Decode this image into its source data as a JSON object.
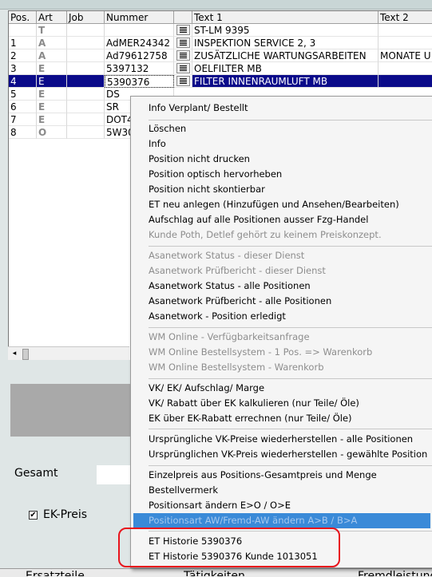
{
  "grid": {
    "columns": [
      "Pos.",
      "Art",
      "Job",
      "Nummer",
      "",
      "Text 1",
      "Text 2"
    ],
    "rows": [
      {
        "pos": "",
        "art": "T",
        "job": "",
        "nummer": "",
        "text1": "ST-LM 9395",
        "text2": ""
      },
      {
        "pos": "1",
        "art": "A",
        "job": "",
        "nummer": "AdMER24342",
        "text1": "INSPEKTION SERVICE 2, 3",
        "text2": ""
      },
      {
        "pos": "2",
        "art": "A",
        "job": "",
        "nummer": "Ad79612758",
        "text1": "ZUSÄTZLICHE WARTUNGSARBEITEN",
        "text2": "MONATE U"
      },
      {
        "pos": "3",
        "art": "E",
        "job": "",
        "nummer": "5397132",
        "text1": "OELFILTER MB",
        "text2": ""
      },
      {
        "pos": "4",
        "art": "E",
        "job": "",
        "nummer": "5390376",
        "text1": "FILTER INNENRAUMLUFT MB",
        "text2": ""
      },
      {
        "pos": "5",
        "art": "E",
        "job": "",
        "nummer": "DS",
        "text1": "",
        "text2": ""
      },
      {
        "pos": "6",
        "art": "E",
        "job": "",
        "nummer": "SR",
        "text1": "",
        "text2": ""
      },
      {
        "pos": "7",
        "art": "E",
        "job": "",
        "nummer": "DOT4",
        "text1": "",
        "text2": ""
      },
      {
        "pos": "8",
        "art": "O",
        "job": "",
        "nummer": "5W30",
        "text1": "",
        "text2": ""
      }
    ],
    "selected_row": 4
  },
  "scrollbar": {
    "left_arrow": "◂"
  },
  "footer": {
    "gesamt_label": "Gesamt",
    "ek_preis_label": "EK-Preis",
    "ek_preis_checked": "✔",
    "tabs": [
      "Ersatzteile",
      "Tätigkeiten",
      "Fremdleistungen"
    ]
  },
  "menu": {
    "items": [
      "Info Verplant/ Bestellt",
      "Löschen",
      "Info",
      "Position nicht drucken",
      "Position optisch hervorheben",
      "Position nicht skontierbar",
      "ET neu anlegen (Hinzufügen und Ansehen/Bearbeiten)",
      "Aufschlag auf alle Positionen ausser Fzg-Handel",
      "Kunde Poth, Detlef gehört zu keinem Preiskonzept.",
      "Asanetwork Status - dieser Dienst",
      "Asanetwork Prüfbericht - dieser Dienst",
      "Asanetwork Status - alle Positionen",
      "Asanetwork Prüfbericht - alle Positionen",
      "Asanetwork - Position erledigt",
      "WM Online - Verfügbarkeitsanfrage",
      "WM Online Bestellsystem - 1 Pos. => Warenkorb",
      "WM Online Bestellsystem - Warenkorb",
      "VK/ EK/ Aufschlag/ Marge",
      "VK/ Rabatt über EK kalkulieren (nur Teile/ Öle)",
      "EK über EK-Rabatt errechnen (nur Teile/ Öle)",
      "Ursprüngliche VK-Preise wiederherstellen - alle Positionen",
      "Ursprünglichen VK-Preis wiederherstellen - gewählte Position",
      "Einzelpreis aus Positions-Gesamtpreis und Menge",
      "Bestellvermerk",
      "Positionsart ändern E>O / O>E",
      "Positionsart AW/Fremd-AW ändern A>B / B>A",
      "ET Historie 5390376",
      "ET Historie 5390376 Kunde 1013051"
    ]
  }
}
